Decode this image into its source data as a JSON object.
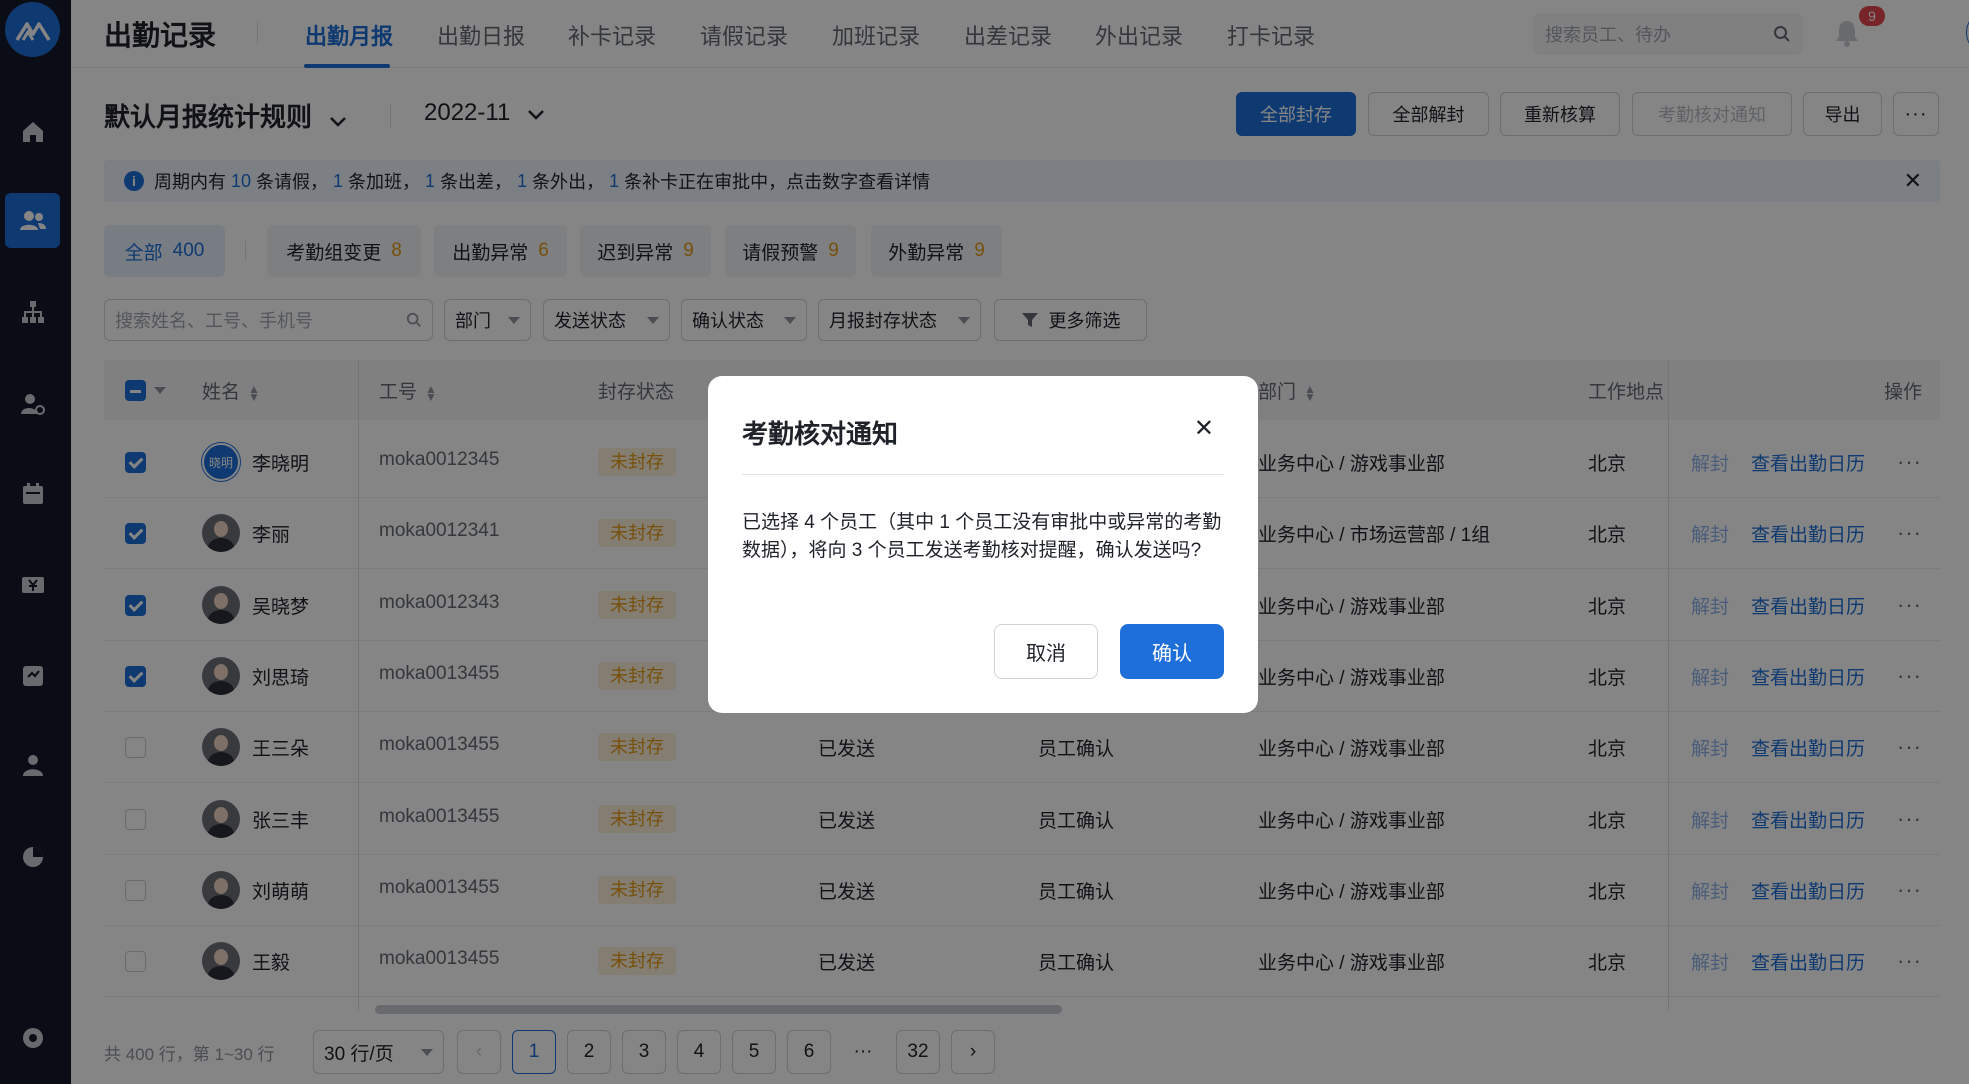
{
  "app": {
    "title": "出勤记录"
  },
  "tabs": [
    "出勤月报",
    "出勤日报",
    "补卡记录",
    "请假记录",
    "加班记录",
    "出差记录",
    "外出记录",
    "打卡记录"
  ],
  "search": {
    "placeholder": "搜索员工、待办"
  },
  "notifications": {
    "count": "9"
  },
  "user": {
    "avatar_text": "晓明"
  },
  "toolbar": {
    "rule": "默认月报统计规则",
    "month": "2022-11",
    "buttons": {
      "archive_all": "全部封存",
      "unarchive_all": "全部解封",
      "recalc": "重新核算",
      "notify": "考勤核对通知",
      "export": "导出"
    }
  },
  "notice": {
    "p1": "周期内有",
    "leave": "10",
    "p2": "条请假，",
    "overtime": "1",
    "p3": "条加班，",
    "trip": "1",
    "p4": "条出差，",
    "out": "1",
    "p5": "条外出，",
    "makeup": "1",
    "p6": "条补卡正在审批中，点击数字查看详情"
  },
  "chips": [
    {
      "label": "全部",
      "count": "400"
    },
    {
      "label": "考勤组变更",
      "count": "8"
    },
    {
      "label": "出勤异常",
      "count": "6"
    },
    {
      "label": "迟到异常",
      "count": "9"
    },
    {
      "label": "请假预警",
      "count": "9"
    },
    {
      "label": "外勤异常",
      "count": "9"
    }
  ],
  "filters": {
    "search_placeholder": "搜索姓名、工号、手机号",
    "dept": "部门",
    "send": "发送状态",
    "confirm": "确认状态",
    "archive": "月报封存状态",
    "more": "更多筛选"
  },
  "table": {
    "headers": {
      "name": "姓名",
      "id": "工号",
      "archive": "封存状态",
      "dept": "部门",
      "location": "工作地点",
      "ops": "操作"
    },
    "rows": [
      {
        "name": "李晓明",
        "avatar": "晓明",
        "id": "moka0012345",
        "archive": "未封存",
        "send": "",
        "confirm": "",
        "dept": "业务中心 / 游戏事业部",
        "location": "北京",
        "checked": true
      },
      {
        "name": "李丽",
        "id": "moka0012341",
        "archive": "未封存",
        "send": "",
        "confirm": "",
        "dept": "业务中心 / 市场运营部 / 1组",
        "location": "北京",
        "checked": true
      },
      {
        "name": "吴晓梦",
        "id": "moka0012343",
        "archive": "未封存",
        "send": "",
        "confirm": "",
        "dept": "业务中心 / 游戏事业部",
        "location": "北京",
        "checked": true
      },
      {
        "name": "刘思琦",
        "id": "moka0013455",
        "archive": "未封存",
        "send": "",
        "confirm": "",
        "dept": "业务中心 / 游戏事业部",
        "location": "北京",
        "checked": true
      },
      {
        "name": "王三朵",
        "id": "moka0013455",
        "archive": "未封存",
        "send": "已发送",
        "confirm": "员工确认",
        "dept": "业务中心 / 游戏事业部",
        "location": "北京",
        "checked": false
      },
      {
        "name": "张三丰",
        "id": "moka0013455",
        "archive": "未封存",
        "send": "已发送",
        "confirm": "员工确认",
        "dept": "业务中心 / 游戏事业部",
        "location": "北京",
        "checked": false
      },
      {
        "name": "刘萌萌",
        "id": "moka0013455",
        "archive": "未封存",
        "send": "已发送",
        "confirm": "员工确认",
        "dept": "业务中心 / 游戏事业部",
        "location": "北京",
        "checked": false
      },
      {
        "name": "王毅",
        "id": "moka0013455",
        "archive": "未封存",
        "send": "已发送",
        "confirm": "员工确认",
        "dept": "业务中心 / 游戏事业部",
        "location": "北京",
        "checked": false
      }
    ],
    "actions": {
      "unarchive": "解封",
      "calendar": "查看出勤日历"
    }
  },
  "pagination": {
    "summary": "共 400 行，第 1~30 行",
    "per_page": "30 行/页",
    "pages": [
      "1",
      "2",
      "3",
      "4",
      "5",
      "6"
    ],
    "ellipsis": "···",
    "last": "32",
    "current": "1"
  },
  "modal": {
    "title": "考勤核对通知",
    "body": "已选择 4 个员工（其中 1 个员工没有审批中或异常的考勤数据），将向 3 个员工发送考勤核对提醒，确认发送吗?",
    "cancel": "取消",
    "confirm": "确认"
  },
  "colors": {
    "primary": "#1e6fd9",
    "sidebar": "#161a2b",
    "warning": "#e59a16"
  }
}
